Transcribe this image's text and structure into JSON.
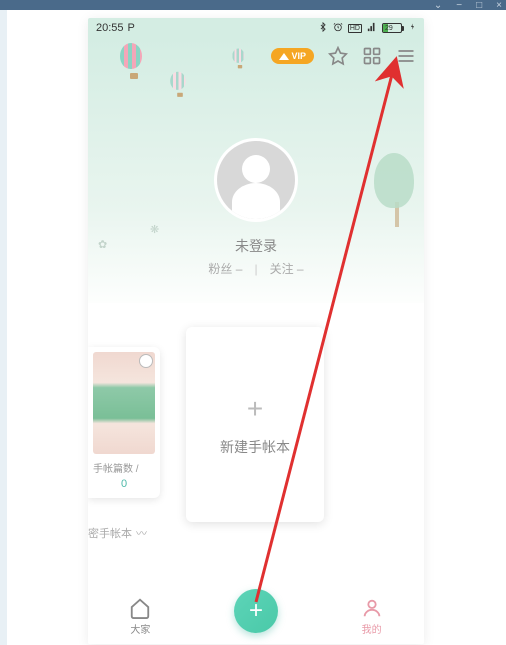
{
  "window": {
    "minimize": "−",
    "maximize": "□",
    "close": "×",
    "dropdown": "⌄"
  },
  "status_bar": {
    "time": "20:55",
    "p_indicator": "P",
    "battery_pct": "29"
  },
  "header": {
    "vip_label": "VIP",
    "username": "未登录",
    "fans_label": "粉丝",
    "fans_count": "–",
    "follow_label": "关注",
    "follow_count": "–"
  },
  "cards": {
    "left_stat_label": "手帐篇数 /",
    "left_stat_count": "0",
    "new_label": "新建手帐本",
    "secret_label": "密手帐本",
    "secret_suffix": "〰"
  },
  "nav": {
    "home_label": "大家",
    "profile_label": "我的"
  }
}
